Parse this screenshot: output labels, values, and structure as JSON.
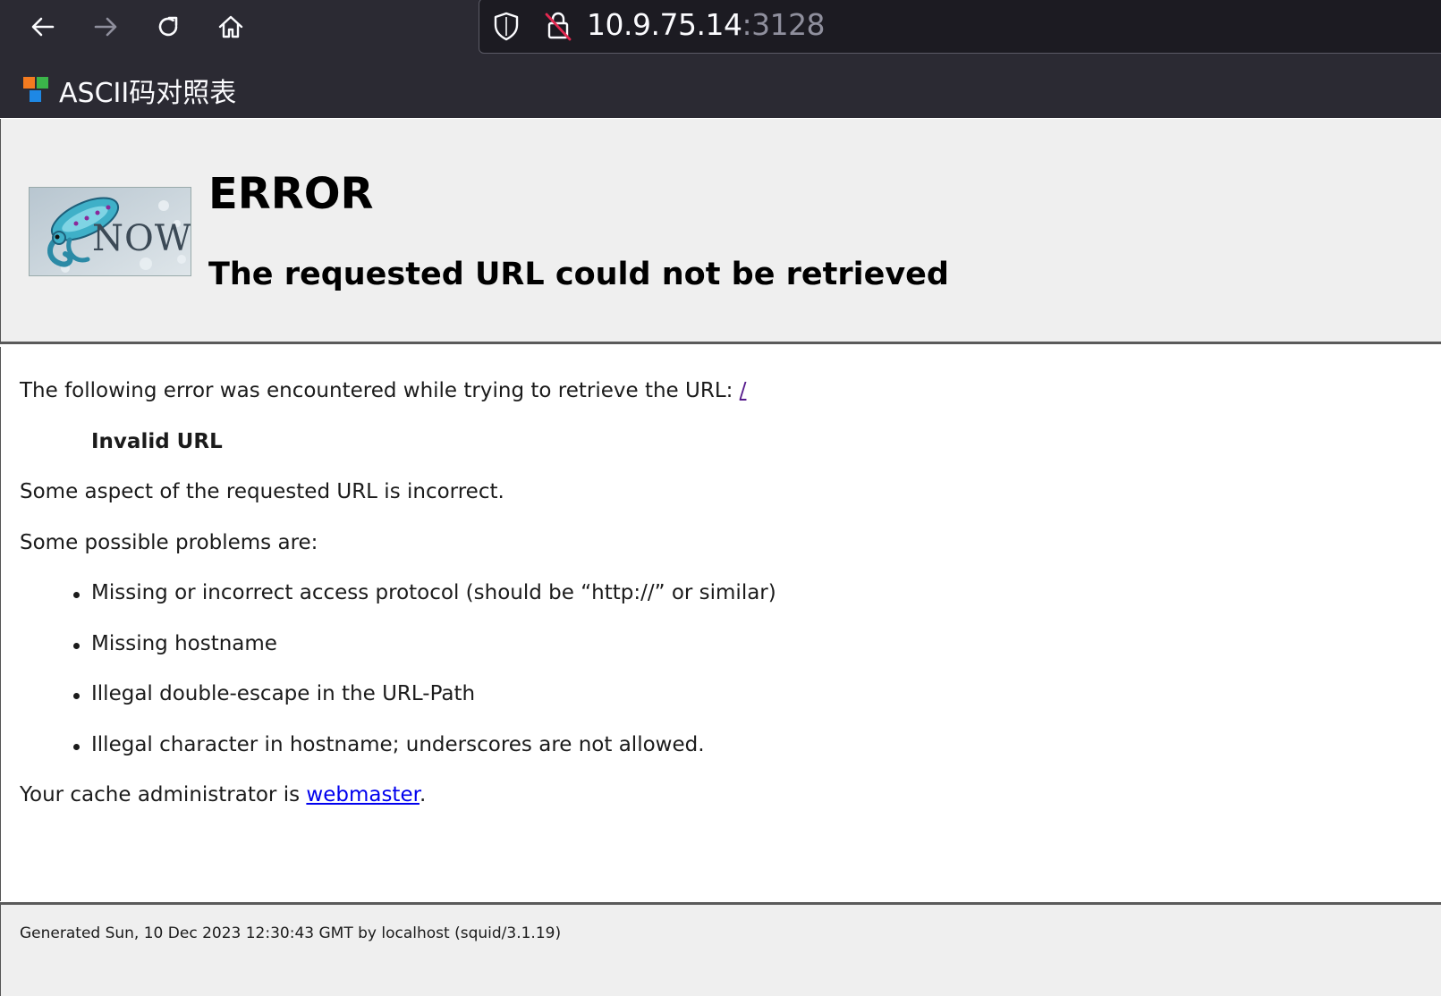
{
  "browser": {
    "url_host": "10.9.75.14",
    "url_port": ":3128",
    "bookmark_label": "ASCII码对照表"
  },
  "header": {
    "logo_text": "NOW",
    "title": "ERROR",
    "subtitle": "The requested URL could not be retrieved"
  },
  "content": {
    "intro": "The following error was encountered while trying to retrieve the URL: ",
    "intro_link": "/",
    "error_name": "Invalid URL",
    "description": "Some aspect of the requested URL is incorrect.",
    "problems_heading": "Some possible problems are:",
    "problems": [
      "Missing or incorrect access protocol (should be “http://” or similar)",
      "Missing hostname",
      "Illegal double-escape in the URL-Path",
      "Illegal character in hostname; underscores are not allowed."
    ],
    "admin_prefix": "Your cache administrator is ",
    "admin_link": "webmaster",
    "admin_suffix": "."
  },
  "footer": {
    "generated": "Generated Sun, 10 Dec 2023 12:30:43 GMT by localhost (squid/3.1.19)"
  },
  "colors": {
    "chrome_bg": "#2b2a33",
    "page_bg": "#efefef",
    "link": "#0000ee",
    "visited_link": "#551a8b"
  }
}
